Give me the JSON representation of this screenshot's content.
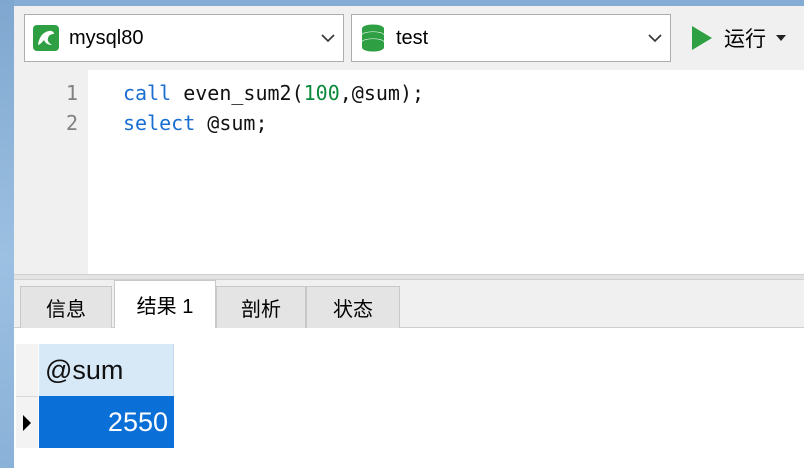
{
  "toolbar": {
    "connection": {
      "value": "mysql80",
      "icon": "mysql-dolphin-icon"
    },
    "database": {
      "value": "test",
      "icon": "database-stack-icon"
    },
    "run_label": "运行"
  },
  "editor": {
    "lines": [
      {
        "number": "1",
        "code": "call even_sum2(100,@sum);"
      },
      {
        "number": "2",
        "code": "select @sum;"
      }
    ]
  },
  "tabs": [
    {
      "label": "信息"
    },
    {
      "label": "结果 1"
    },
    {
      "label": "剖析"
    },
    {
      "label": "状态"
    }
  ],
  "active_tab": "结果 1",
  "result_grid": {
    "columns": [
      "@sum"
    ],
    "rows": [
      [
        "2550"
      ]
    ]
  },
  "colors": {
    "selection": "#0a6fd6",
    "keyword": "#1a6fd0",
    "number": "#0b8a3b",
    "run_green": "#2ea043"
  }
}
